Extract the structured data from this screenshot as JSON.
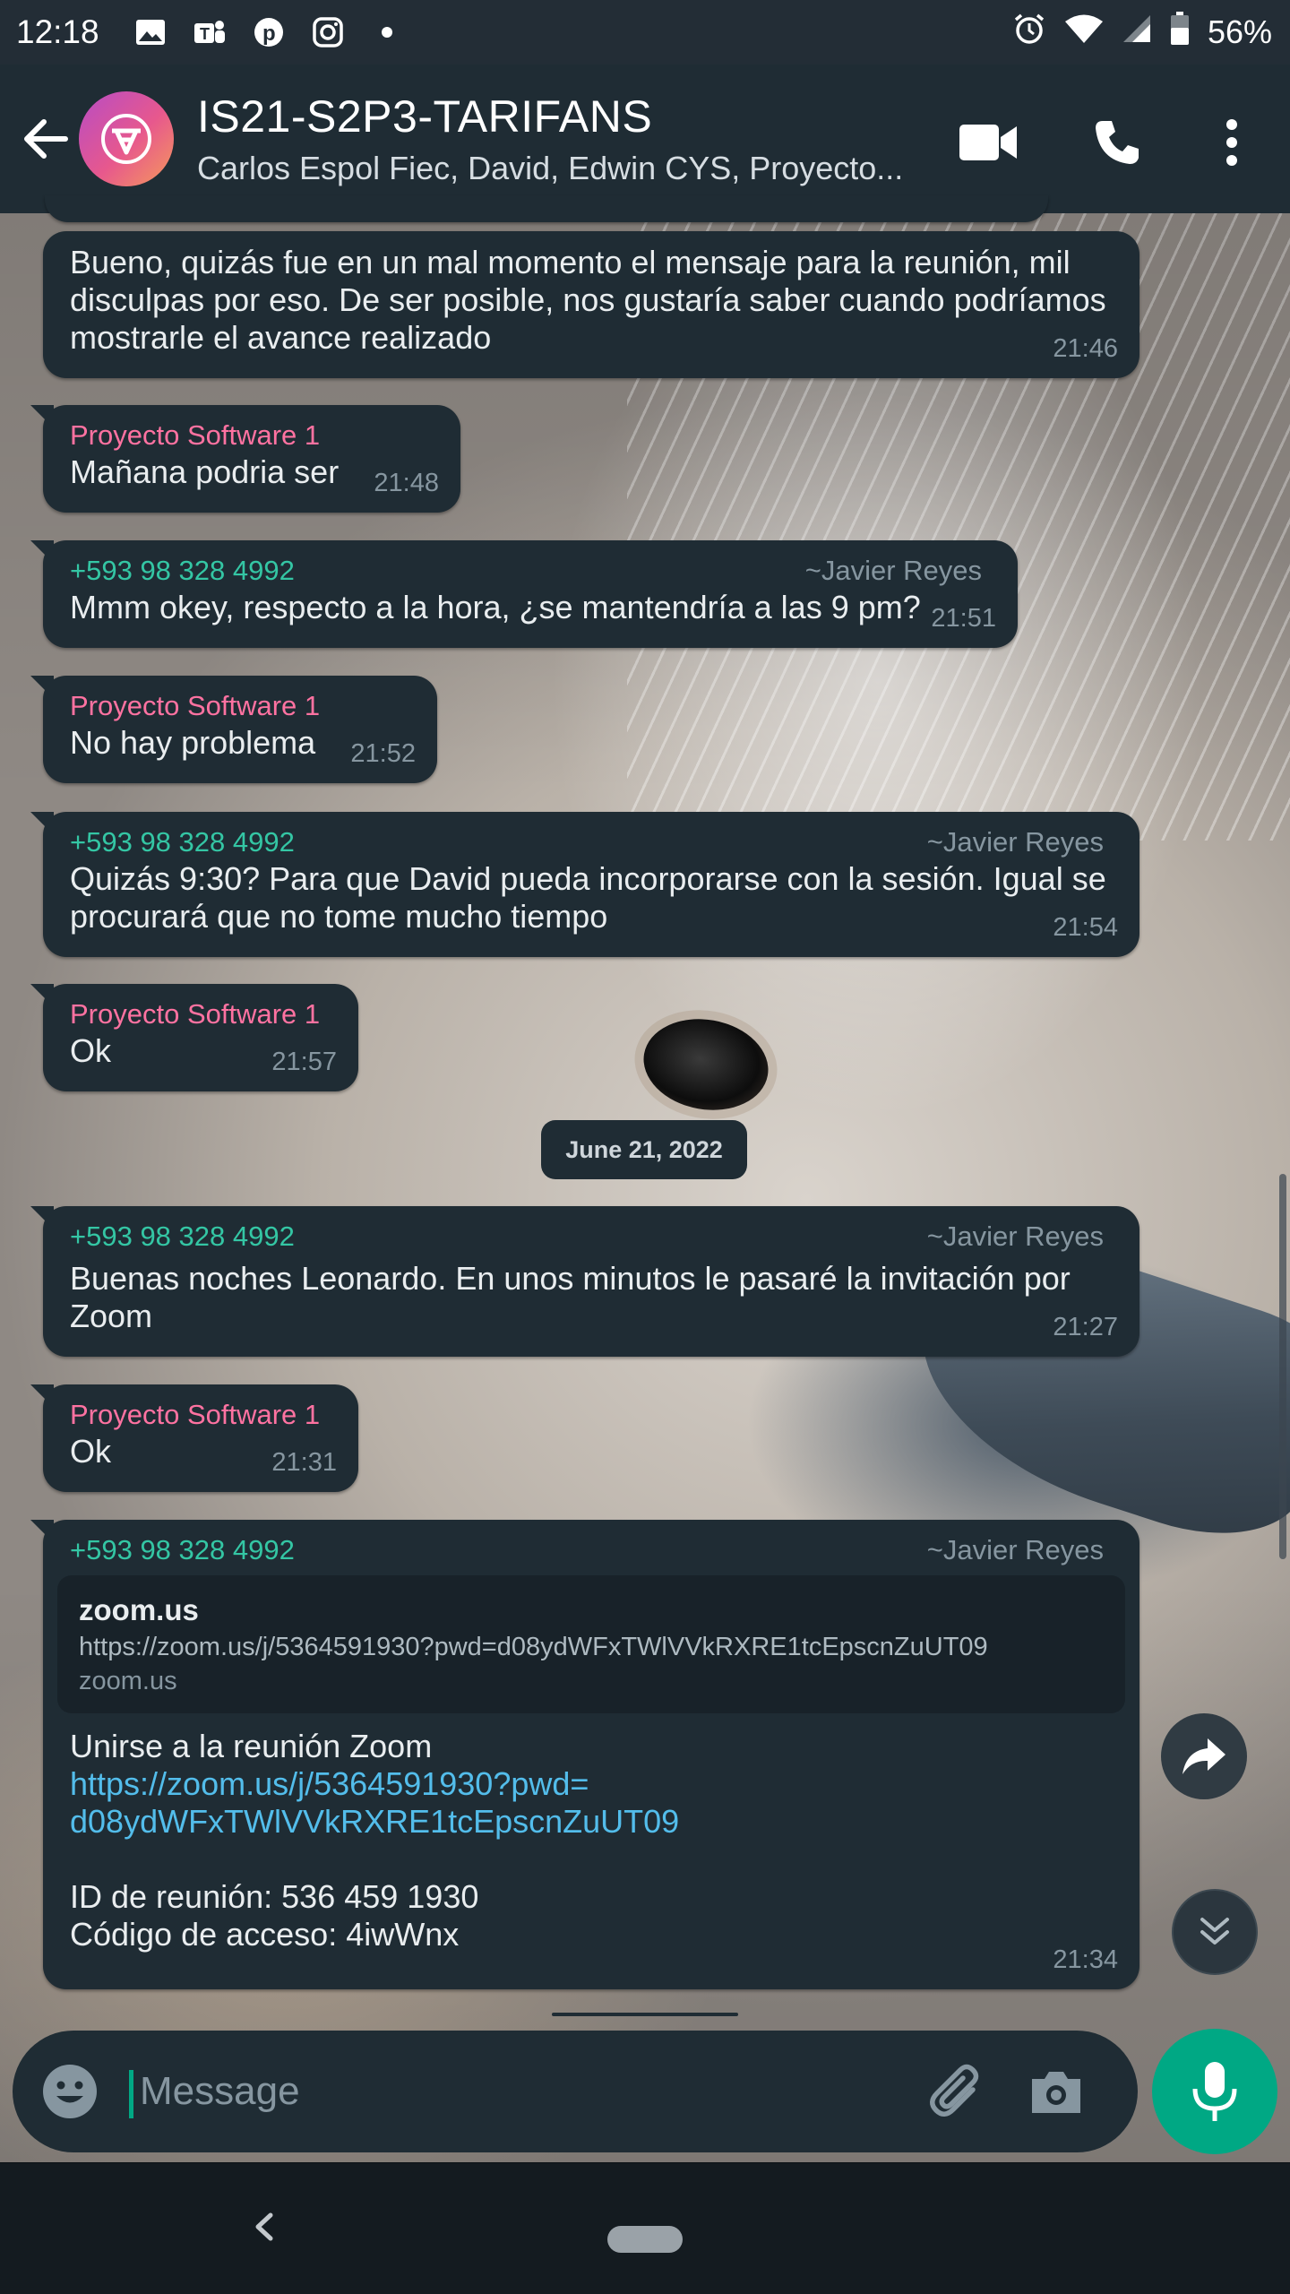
{
  "status_bar": {
    "time": "12:18",
    "battery": "56%",
    "notification_icons": [
      "gallery-icon",
      "teams-icon",
      "pinterest-icon",
      "instagram-icon",
      "dot-icon"
    ],
    "system_icons": [
      "alarm-icon",
      "wifi-icon",
      "signal-icon",
      "battery-icon"
    ]
  },
  "header": {
    "title": "IS21-S2P3-TARIFANS",
    "members": "Carlos Espol Fiec, David, Edwin CYS, Proyecto...",
    "icons": [
      "back-arrow-icon",
      "video-call-icon",
      "phone-icon",
      "more-options-icon"
    ]
  },
  "messages": [
    {
      "text": "Bueno, quizás fue en un mal momento el mensaje para la reunión, mil disculpas por eso. De ser posible, nos gustaría saber cuando podríamos mostrarle el avance realizado",
      "time": "21:46"
    },
    {
      "sender": "Proyecto Software 1",
      "text": "Mañana podria ser",
      "time": "21:48"
    },
    {
      "sender": "+593 98 328 4992",
      "alias": "~Javier Reyes",
      "text": "Mmm okey, respecto a la hora, ¿se mantendría a las 9 pm?",
      "time": "21:51"
    },
    {
      "sender": "Proyecto Software 1",
      "text": "No hay problema",
      "time": "21:52"
    },
    {
      "sender": "+593 98 328 4992",
      "alias": "~Javier Reyes",
      "text": "Quizás 9:30? Para que David pueda incorporarse con la sesión. Igual se procurará que no tome mucho tiempo",
      "time": "21:54"
    },
    {
      "sender": "Proyecto Software 1",
      "text": "Ok",
      "time": "21:57"
    },
    {
      "sender": "+593 98 328 4992",
      "alias": "~Javier Reyes",
      "text": "Buenas noches Leonardo. En unos minutos le pasaré la invitación por Zoom",
      "time": "21:27"
    },
    {
      "sender": "Proyecto Software 1",
      "text": "Ok",
      "time": "21:31"
    },
    {
      "sender": "+593 98 328 4992",
      "alias": "~Javier Reyes",
      "preview": {
        "title": "zoom.us",
        "url": "https://zoom.us/j/5364591930?pwd=d08ydWFxTWlVVkRXRE1tcEpscnZuUT09",
        "domain": "zoom.us"
      },
      "line1": "Unirse a la reunión Zoom",
      "link_part1": "https://zoom.us/j/5364591930?pwd=",
      "link_part2": "d08ydWFxTWlVVkRXRE1tcEpscnZuUT09",
      "meeting_id": "ID de reunión: 536 459 1930",
      "access_code": "Código de acceso: 4iwWnx",
      "time": "21:34"
    }
  ],
  "date_chip": "June 21, 2022",
  "input": {
    "placeholder": "Message"
  },
  "colors": {
    "header_bg": "#1f2c34",
    "bubble_bg": "#1f2c34",
    "accent_green": "#00a884",
    "sender_pink": "#ff72a1",
    "sender_green": "#34c6a4",
    "link_blue": "#53bdeb"
  }
}
